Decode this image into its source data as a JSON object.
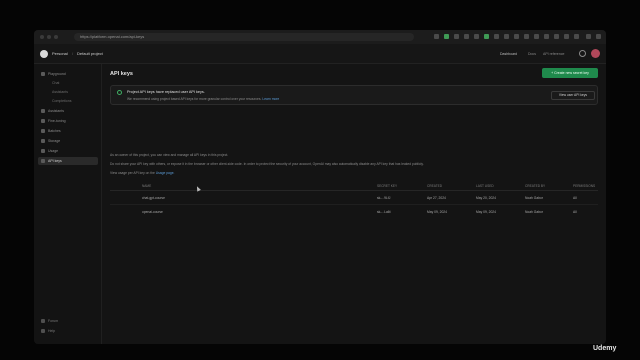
{
  "browser": {
    "url": "https://platform.openai.com/api-keys"
  },
  "header": {
    "org": "Personal",
    "project": "Default project",
    "links": [
      "Dashboard",
      "Docs",
      "API reference"
    ]
  },
  "sidebar": {
    "items": [
      {
        "label": "Playground",
        "sub": false,
        "active": false
      },
      {
        "label": "Chat",
        "sub": true,
        "active": false
      },
      {
        "label": "Assistants",
        "sub": true,
        "active": false
      },
      {
        "label": "Completions",
        "sub": true,
        "active": false
      },
      {
        "label": "Assistants",
        "sub": false,
        "active": false
      },
      {
        "label": "Fine-tuning",
        "sub": false,
        "active": false
      },
      {
        "label": "Batches",
        "sub": false,
        "active": false
      },
      {
        "label": "Storage",
        "sub": false,
        "active": false
      },
      {
        "label": "Usage",
        "sub": false,
        "active": false
      },
      {
        "label": "API keys",
        "sub": false,
        "active": true
      }
    ],
    "footer": [
      {
        "label": "Forum"
      },
      {
        "label": "Help"
      }
    ]
  },
  "main": {
    "title": "API keys",
    "create_button": "+ Create new secret key",
    "banner": {
      "title": "Project API keys have replaced user API keys.",
      "text": "We recommend using project based API keys for more granular control over your resources.",
      "link": "Learn more",
      "button": "View user API keys"
    },
    "paragraphs": [
      {
        "text": "As an owner of this project, you can view and manage all API keys in this project.",
        "link": ""
      },
      {
        "text": "Do not share your API key with others, or expose it in the browser or other client-side code. In order to protect the security of your account, OpenAI may also automatically disable any API key that has leaked publicly.",
        "link": ""
      },
      {
        "text": "View usage per API key on the",
        "link": "Usage page."
      }
    ],
    "table": {
      "headers": [
        "Name",
        "Secret key",
        "Created",
        "Last used",
        "Created by",
        "Permissions"
      ],
      "rows": [
        {
          "name": "chat-gpt-course",
          "key": "sk-...9LfJ",
          "created": "Apr 27, 2024",
          "last_used": "May 20, 2024",
          "created_by": "Noah Gabor",
          "permissions": "All"
        },
        {
          "name": "openai-course",
          "key": "sk-...La6t",
          "created": "May 09, 2024",
          "last_used": "May 09, 2024",
          "created_by": "Noah Gabor",
          "permissions": "All"
        }
      ]
    }
  },
  "watermark": "Udemy",
  "colors": {
    "accent": "#1f8a4c",
    "link": "#5b9bd5",
    "danger": "#c14444"
  }
}
